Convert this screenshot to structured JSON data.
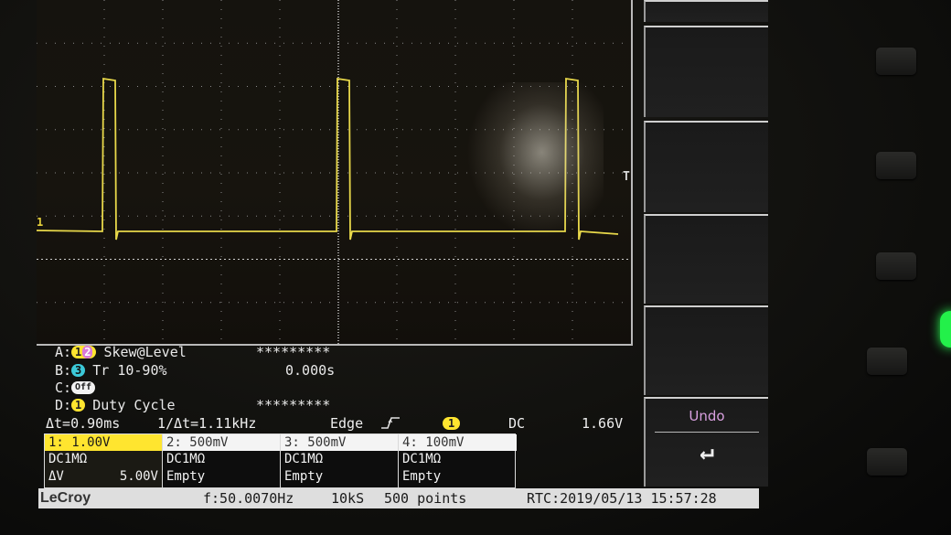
{
  "scope": {
    "channel1_marker": "1",
    "trigger_marker": "T"
  },
  "measurements": [
    {
      "slot": "A:",
      "source": "1",
      "source2": "2",
      "name": "Skew@Level",
      "value": "*********"
    },
    {
      "slot": "B:",
      "source": "3",
      "name": "Tr 10-90%",
      "value": "0.000s"
    },
    {
      "slot": "C:",
      "source": "Off",
      "name": "",
      "value": ""
    },
    {
      "slot": "D:",
      "source": "1",
      "name": "Duty Cycle",
      "value": "*********"
    }
  ],
  "timebar": {
    "delta_t": "Δt=0.90ms",
    "inv_delta_t": "1/Δt=1.11kHz",
    "trigger_type": "Edge",
    "trigger_source": "1",
    "coupling": "DC",
    "trigger_level": "1.66V"
  },
  "channels": [
    {
      "head": "1: 1.00V",
      "line1": "DC1MΩ",
      "line2_left": "ΔV",
      "line2_right": "5.00V"
    },
    {
      "head": "2: 500mV",
      "line1": "DC1MΩ",
      "line2_left": "Empty",
      "line2_right": ""
    },
    {
      "head": "3: 500mV",
      "line1": "DC1MΩ",
      "line2_left": "Empty",
      "line2_right": ""
    },
    {
      "head": "4: 100mV",
      "line1": "DC1MΩ",
      "line2_left": "Empty",
      "line2_right": ""
    }
  ],
  "status": {
    "brand": "LeCroy",
    "frequency": "f:50.0070Hz",
    "sample_rate": "10kS",
    "points": "500 points",
    "rtc": "RTC:2019/05/13 15:57:28"
  },
  "softkeys": {
    "undo_label": "Undo",
    "enter_symbol": "↵"
  },
  "colors": {
    "trace": "#e8d84a",
    "ch1": "#ffe52f",
    "ch2_pill": "#d97ad8",
    "ch3_pill": "#3cc9d8",
    "softkey_text": "#d9a0e0",
    "led": "#23f04a"
  }
}
